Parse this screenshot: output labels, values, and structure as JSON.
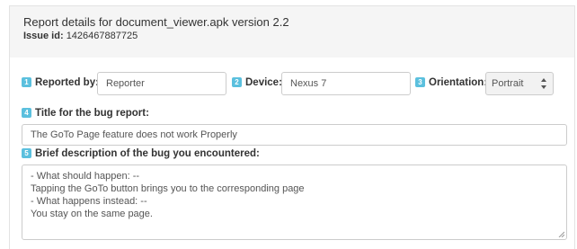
{
  "header": {
    "title": "Report details for document_viewer.apk version 2.2",
    "issue_label": "Issue id:",
    "issue_value": "1426467887725"
  },
  "form": {
    "reporter": {
      "badge": "1",
      "label": "Reported by:",
      "value": "Reporter"
    },
    "device": {
      "badge": "2",
      "label": "Device:",
      "value": "Nexus 7"
    },
    "orientation": {
      "badge": "3",
      "label": "Orientation:",
      "value": "Portrait"
    },
    "title": {
      "badge": "4",
      "label": "Title for the bug report:",
      "value": "The GoTo Page feature does not work Properly"
    },
    "description": {
      "badge": "5",
      "label": "Brief description of the bug you encountered:",
      "lines": [
        "- What should happen: --",
        "Tapping the GoTo button brings you to the corresponding page",
        "- What happens instead: --",
        "You stay on the same page."
      ]
    }
  },
  "colors": {
    "badge": "#5bc0de",
    "header_bg": "#f5f5f5",
    "border": "#cccccc"
  },
  "icons": {
    "orientation_arrows": "up-down-arrows-icon",
    "resize": "resize-grip-icon"
  }
}
